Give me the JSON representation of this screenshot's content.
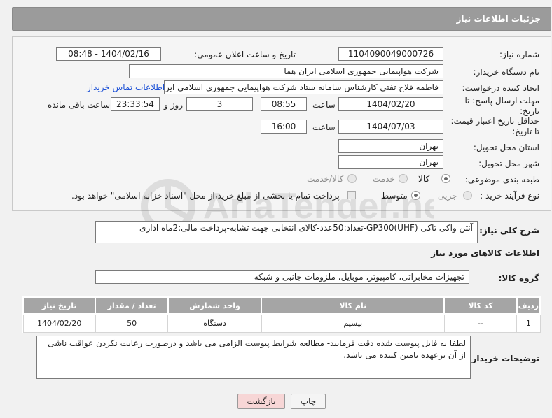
{
  "header": {
    "title": "جزئیات اطلاعات نیاز"
  },
  "form": {
    "need_number": {
      "label": "شماره نیاز:",
      "value": "1104090049000726"
    },
    "announce_datetime": {
      "label": "تاریخ و ساعت اعلان عمومی:",
      "value": "1404/02/16 - 08:48"
    },
    "buyer_org": {
      "label": "نام دستگاه خریدار:",
      "value": "شرکت هواپیمایی جمهوری اسلامی ایران هما"
    },
    "requester": {
      "label": "ایجاد کننده درخواست:",
      "value": "فاطمه فلاح تفتی کارشناس سامانه ستاد شرکت هواپیمایی جمهوری اسلامی ایران هما",
      "contact_link": "اطلاعات تماس خریدار"
    },
    "reply_deadline": {
      "label_line1": "مهلت ارسال پاسخ: تا",
      "label_line2": "تاریخ:",
      "date": "1404/02/20",
      "time_label": "ساعت",
      "time": "08:55",
      "days": "3",
      "days_label": "روز و",
      "remaining": "23:33:54",
      "remaining_label": "ساعت باقی مانده"
    },
    "price_validity": {
      "label_line1": "حداقل تاریخ اعتبار قیمت:",
      "label_line2": "تا تاریخ:",
      "date": "1404/07/03",
      "time_label": "ساعت",
      "time": "16:00"
    },
    "province": {
      "label": "استان محل تحویل:",
      "value": "تهران"
    },
    "city": {
      "label": "شهر محل تحویل:",
      "value": "تهران"
    },
    "category": {
      "label": "طبقه بندی موضوعی:",
      "options": [
        "کالا",
        "خدمت",
        "کالا/خدمت"
      ],
      "selected": "کالا"
    },
    "purchase_process": {
      "label": "نوع فرآیند خرید :",
      "options": [
        "جزیی",
        "متوسط"
      ],
      "selected": "متوسط",
      "payment_note": "پرداخت تمام یا بخشی از مبلغ خرید،از محل \"اسناد خزانه اسلامی\" خواهد بود."
    }
  },
  "description": {
    "label": "شرح کلی نیاز:",
    "value": "آنتن واکی تاکی GP300(UHF)-تعداد:50عدد-کالای انتخابی جهت تشابه-پرداخت مالی:2ماه اداری"
  },
  "goods_section": {
    "title": "اطلاعات کالاهای مورد نیاز",
    "group_label": "گروه کالا:",
    "group_value": "تجهیزات مخابراتی، کامپیوتر، موبایل، ملزومات جانبی و شبکه"
  },
  "table": {
    "headers": [
      "ردیف",
      "کد کالا",
      "نام کالا",
      "واحد شمارش",
      "تعداد / مقدار",
      "تاریخ نیاز"
    ],
    "rows": [
      {
        "row": "1",
        "code": "--",
        "name": "بیسیم",
        "unit": "دستگاه",
        "qty": "50",
        "date": "1404/02/20"
      }
    ]
  },
  "buyer_notes": {
    "label": "توضیحات خریدار:",
    "value": "لطفا به فایل پیوست شده دقت فرمایید- مطالعه شرایط پیوست الزامی می باشد و درصورت رعایت نکردن عواقب ناشی از آن برعهده تامین کننده می باشد."
  },
  "buttons": {
    "print": "چاپ",
    "back": "بازگشت"
  },
  "watermark": {
    "text": "AriaTender.net"
  },
  "colors": {
    "header_bg": "#9b9b9b",
    "link": "#1a4fd6",
    "back_button_bg": "#f7d6d6"
  }
}
